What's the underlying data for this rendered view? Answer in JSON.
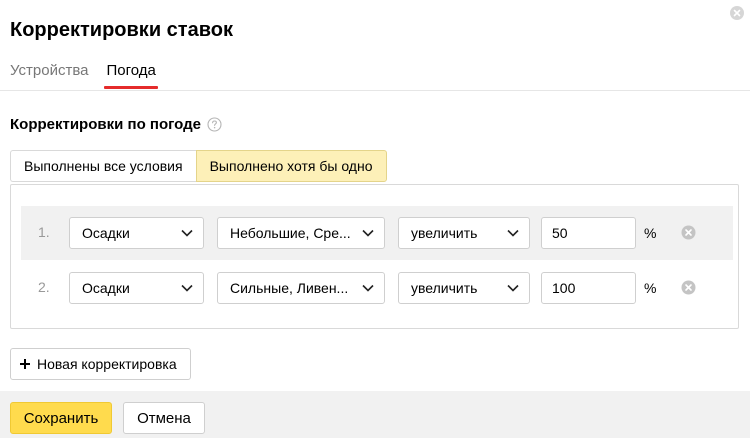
{
  "dialog": {
    "title": "Корректировки ставок",
    "close_icon": "close-icon"
  },
  "tabs": [
    {
      "label": "Устройства",
      "active": false
    },
    {
      "label": "Погода",
      "active": true
    }
  ],
  "section": {
    "title": "Корректировки по погоде",
    "help_icon": "question-circle-icon"
  },
  "mode": {
    "options": [
      "Выполнены все условия",
      "Выполнено хотя бы одно"
    ],
    "selected": "Выполнено хотя бы одно"
  },
  "rules": [
    {
      "number": "1.",
      "condition": "Осадки",
      "value": "Небольшие, Сре...",
      "direction": "увеличить",
      "amount": "50",
      "unit": "%"
    },
    {
      "number": "2.",
      "condition": "Осадки",
      "value": "Сильные, Ливен...",
      "direction": "увеличить",
      "amount": "100",
      "unit": "%"
    }
  ],
  "add_button": {
    "label": "Новая корректировка",
    "icon": "plus-icon"
  },
  "footer": {
    "save_label": "Сохранить",
    "cancel_label": "Отмена"
  },
  "colors": {
    "accent_yellow": "#ffdb4d",
    "selected_segment": "#fdf0b8",
    "tab_underline": "#e52b2b",
    "footer_bg": "#f1f1f1"
  }
}
